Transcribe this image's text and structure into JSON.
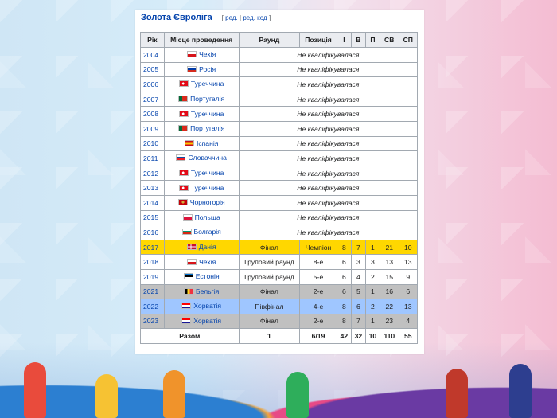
{
  "heading": {
    "title": "Золота Євроліга",
    "edit_open": "[",
    "edit_label": "ред.",
    "sep": "|",
    "edit_code_label": "ред. код",
    "edit_close": "]"
  },
  "table": {
    "headers": [
      "Рік",
      "Місце проведення",
      "Раунд",
      "Позиція",
      "І",
      "В",
      "П",
      "СВ",
      "СП"
    ],
    "not_qualified_label": "Не кваліфікувалася",
    "rows": [
      {
        "year": "2004",
        "host": "Чехія",
        "flag": "cz"
      },
      {
        "year": "2005",
        "host": "Росія",
        "flag": "ru"
      },
      {
        "year": "2006",
        "host": "Туреччина",
        "flag": "tr"
      },
      {
        "year": "2007",
        "host": "Португалія",
        "flag": "pt"
      },
      {
        "year": "2008",
        "host": "Туреччина",
        "flag": "tr"
      },
      {
        "year": "2009",
        "host": "Португалія",
        "flag": "pt"
      },
      {
        "year": "2010",
        "host": "Іспанія",
        "flag": "es"
      },
      {
        "year": "2011",
        "host": "Словаччина",
        "flag": "sk"
      },
      {
        "year": "2012",
        "host": "Туреччина",
        "flag": "tr"
      },
      {
        "year": "2013",
        "host": "Туреччина",
        "flag": "tr"
      },
      {
        "year": "2014",
        "host": "Чорногорія",
        "flag": "me"
      },
      {
        "year": "2015",
        "host": "Польща",
        "flag": "pl"
      },
      {
        "year": "2016",
        "host": "Болгарія",
        "flag": "bg"
      },
      {
        "year": "2017",
        "host": "Данія",
        "flag": "dk",
        "round": "Фінал",
        "position": "Чемпіон",
        "i": "8",
        "v": "7",
        "p": "1",
        "sv": "21",
        "sp": "10",
        "style": "gold"
      },
      {
        "year": "2018",
        "host": "Чехія",
        "flag": "cz",
        "round": "Груповий раунд",
        "position": "8-е",
        "i": "6",
        "v": "3",
        "p": "3",
        "sv": "13",
        "sp": "13",
        "style": ""
      },
      {
        "year": "2019",
        "host": "Естонія",
        "flag": "ee",
        "round": "Груповий раунд",
        "position": "5-е",
        "i": "6",
        "v": "4",
        "p": "2",
        "sv": "15",
        "sp": "9",
        "style": ""
      },
      {
        "year": "2021",
        "host": "Бельгія",
        "flag": "be",
        "round": "Фінал",
        "position": "2-е",
        "i": "6",
        "v": "5",
        "p": "1",
        "sv": "16",
        "sp": "6",
        "style": "silver"
      },
      {
        "year": "2022",
        "host": "Хорватія",
        "flag": "hr",
        "round": "Півфінал",
        "position": "4-е",
        "i": "8",
        "v": "6",
        "p": "2",
        "sv": "22",
        "sp": "13",
        "style": "bronze"
      },
      {
        "year": "2023",
        "host": "Хорватія",
        "flag": "hr",
        "round": "Фінал",
        "position": "2-е",
        "i": "8",
        "v": "7",
        "p": "1",
        "sv": "23",
        "sp": "4",
        "style": "silver"
      }
    ],
    "total": {
      "label": "Разом",
      "round": "1",
      "position": "6/19",
      "i": "42",
      "v": "32",
      "p": "10",
      "sv": "110",
      "sp": "55"
    }
  },
  "colors": {
    "link": "#0645ad",
    "gold": "#ffd700",
    "silver": "#c0c0c0",
    "bronze": "#9fc6ff",
    "header_bg": "#eaecf0"
  }
}
